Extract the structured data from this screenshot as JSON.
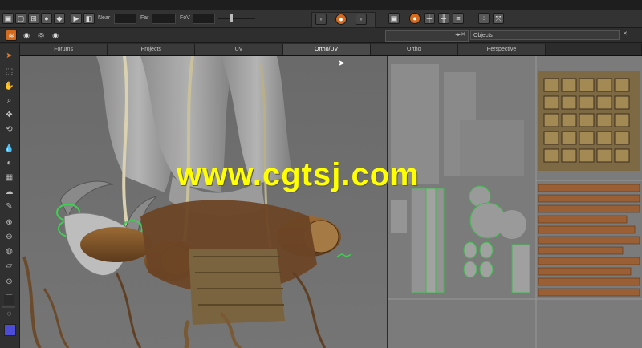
{
  "toolbar": {
    "near_label": "Near",
    "far_label": "Far",
    "fov_label": "FoV"
  },
  "panels": {
    "objects_label": "Objects"
  },
  "tabs": [
    {
      "label": "Forums"
    },
    {
      "label": "Projects"
    },
    {
      "label": "UV"
    },
    {
      "label": "Ortho/UV"
    },
    {
      "label": "Ortho"
    },
    {
      "label": "Perspective"
    }
  ],
  "active_tab": "Ortho/UV",
  "watermark": "www.cgtsj.com",
  "colors": {
    "accent": "#d26b1e",
    "watermark": "#ffff00",
    "viewport_bg": "#6e6e6e",
    "uv_bg": "#7a7a7a"
  }
}
